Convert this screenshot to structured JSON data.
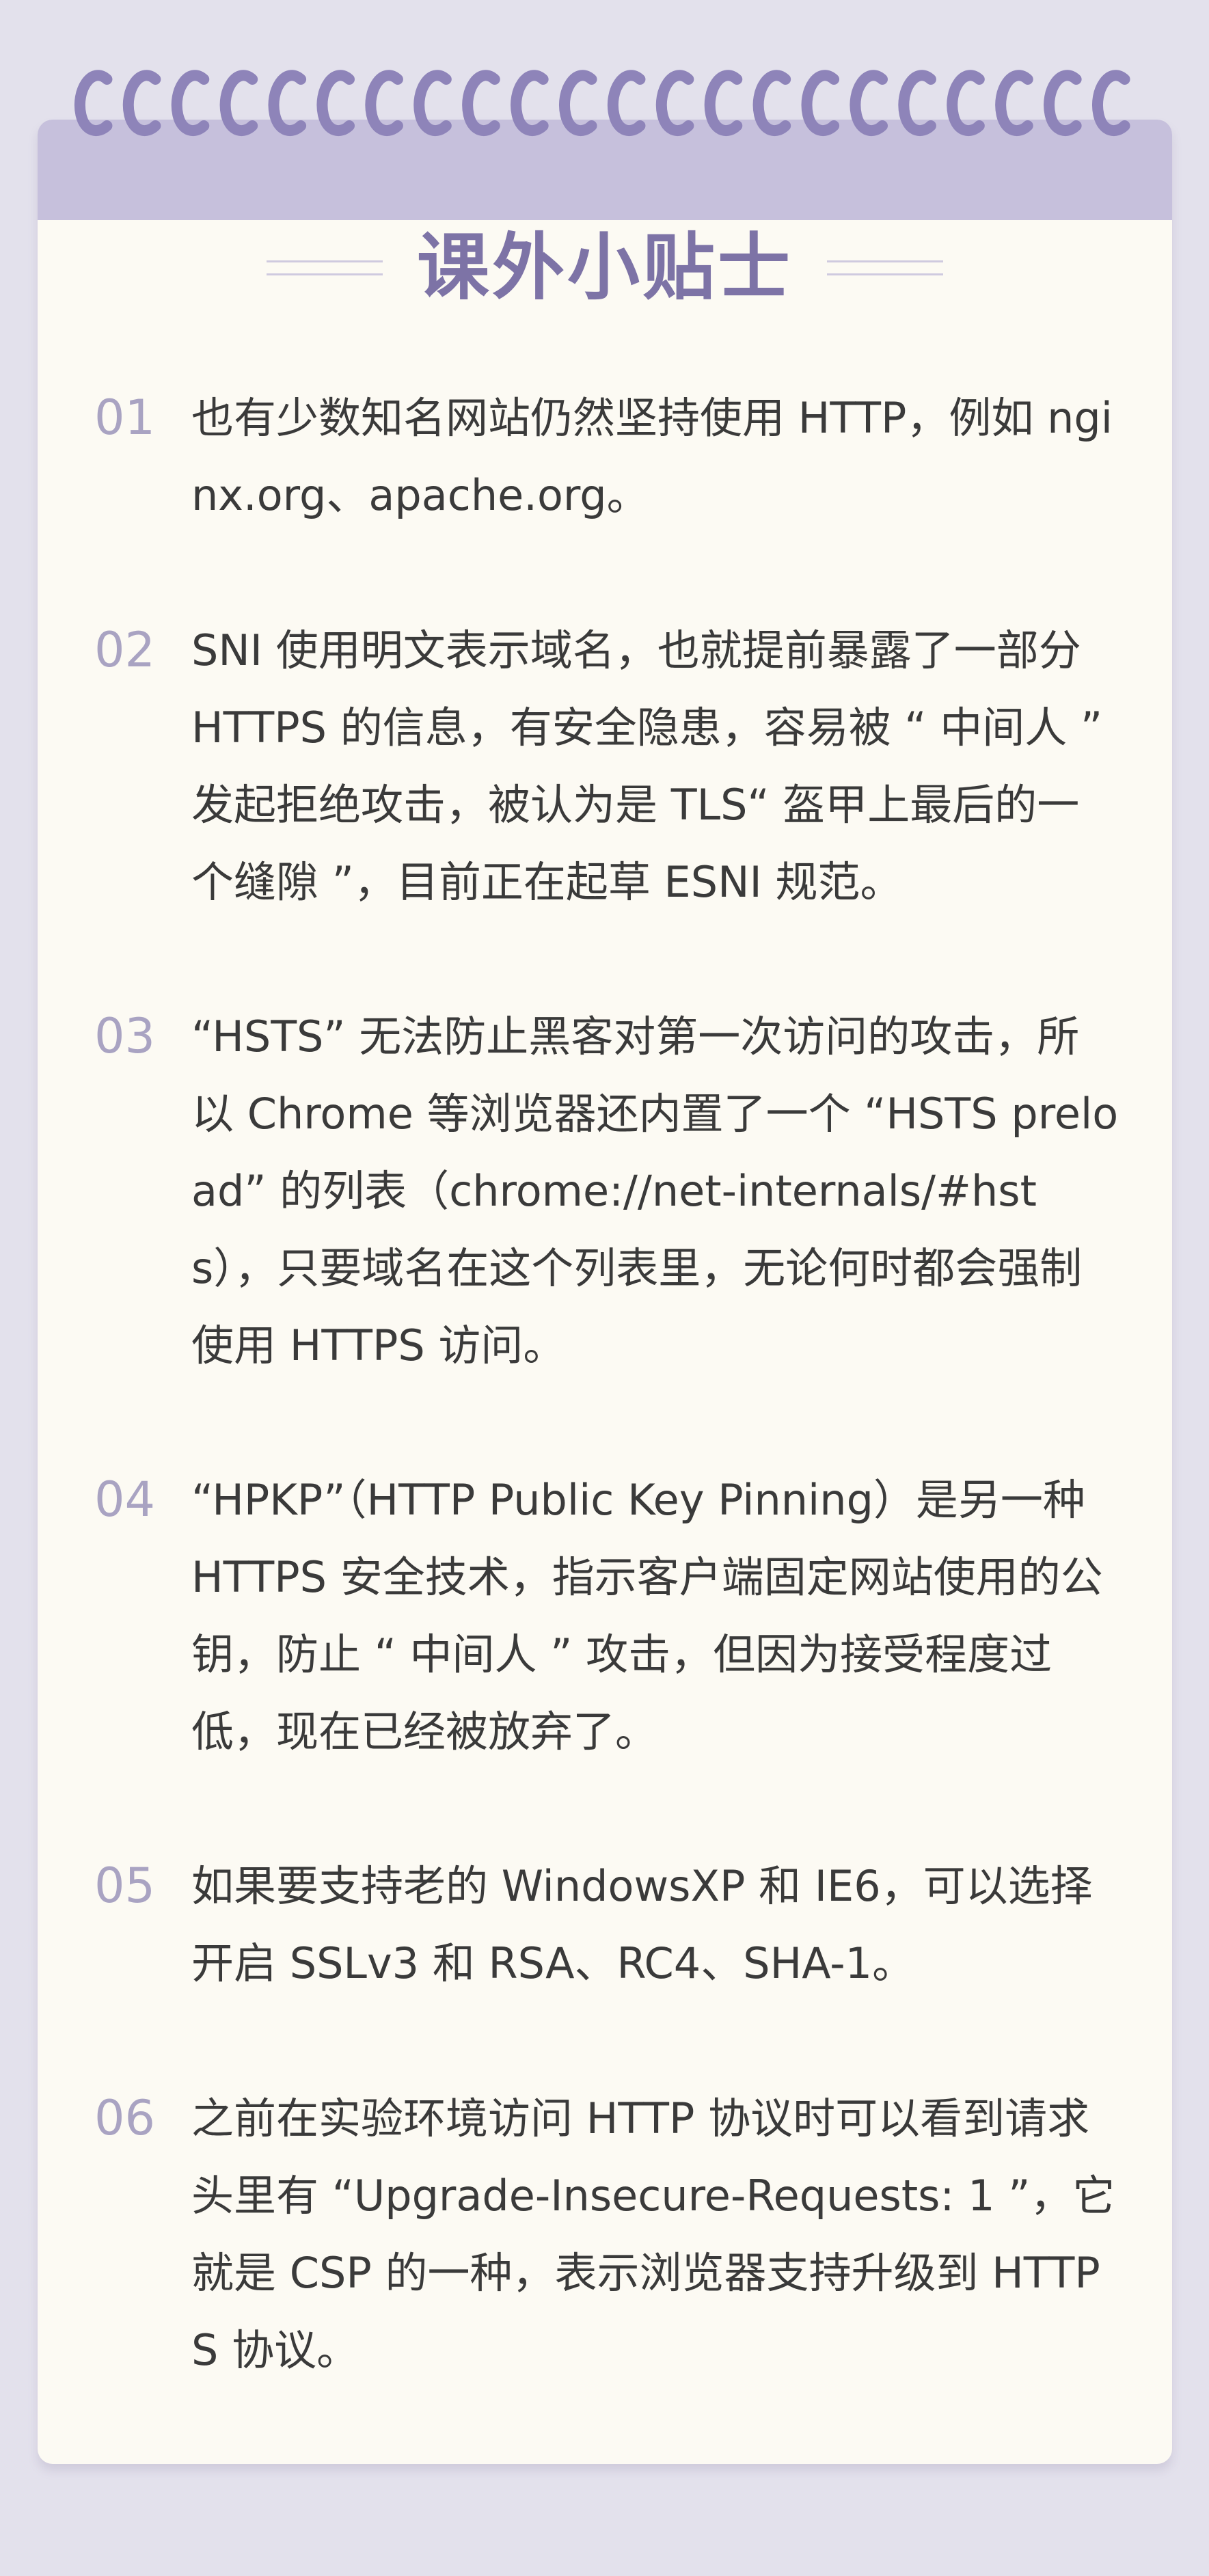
{
  "header": {
    "title": "课外小贴士"
  },
  "tips": [
    {
      "num": "01",
      "text": "也有少数知名网站仍然坚持使用 HTTP，例如 nginx.org、apache.org。"
    },
    {
      "num": "02",
      "text": "SNI 使用明文表示域名，也就提前暴露了一部分 HTTPS 的信息，有安全隐患，容易被 “ 中间人 ” 发起拒绝攻击，被认为是 TLS“ 盔甲上最后的一个缝隙 ”，目前正在起草 ESNI 规范。"
    },
    {
      "num": "03",
      "text": "“HSTS” 无法防止黑客对第一次访问的攻击，所以 Chrome 等浏览器还内置了一个 “HSTS preload” 的列表（chrome://net-internals/#hsts），只要域名在这个列表里，无论何时都会强制使用 HTTPS 访问。"
    },
    {
      "num": "04",
      "text": "“HPKP”（HTTP Public Key Pinning）是另一种 HTTPS 安全技术，指示客户端固定网站使用的公钥，防止 “ 中间人 ” 攻击，但因为接受程度过低，现在已经被放弃了。"
    },
    {
      "num": "05",
      "text": "如果要支持老的 WindowsXP 和 IE6，可以选择开启 SSLv3 和 RSA、RC4、SHA-1。"
    },
    {
      "num": "06",
      "text": "之前在实验环境访问 HTTP 协议时可以看到请求头里有 “Upgrade-Insecure-Requests: 1 ”，它就是 CSP 的一种，表示浏览器支持升级到 HTTPS 协议。"
    }
  ],
  "colors": {
    "background": "#e3e1ec",
    "card": "#fcfaf3",
    "header_band": "#c6c0dc",
    "accent": "#7d73a6",
    "number": "#a9a3c2"
  }
}
